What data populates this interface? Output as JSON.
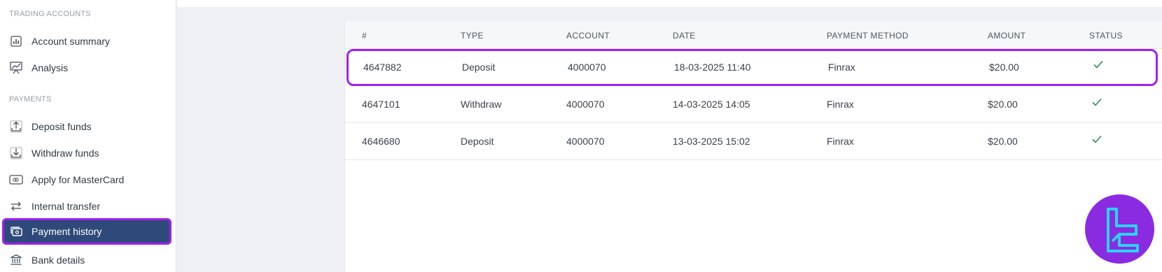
{
  "sidebar": {
    "trading_title": "TRADING ACCOUNTS",
    "payments_title": "PAYMENTS",
    "items": [
      {
        "label": "Account summary",
        "icon": "chart-bars-icon"
      },
      {
        "label": "Analysis",
        "icon": "line-chart-board-icon"
      },
      {
        "label": "Deposit funds",
        "icon": "upload-tray-icon"
      },
      {
        "label": "Withdraw funds",
        "icon": "download-tray-icon"
      },
      {
        "label": "Apply for MasterCard",
        "icon": "card-icon"
      },
      {
        "label": "Internal transfer",
        "icon": "swap-arrows-icon"
      },
      {
        "label": "Payment history",
        "icon": "cash-stack-icon",
        "active": true
      },
      {
        "label": "Bank details",
        "icon": "bank-icon"
      }
    ]
  },
  "table": {
    "headers": [
      "#",
      "TYPE",
      "ACCOUNT",
      "DATE",
      "PAYMENT METHOD",
      "AMOUNT",
      "STATUS"
    ],
    "rows": [
      {
        "id": "4647882",
        "type": "Deposit",
        "account": "4000070",
        "date": "18-03-2025 11:40",
        "method": "Finrax",
        "amount": "$20.00",
        "status": "check-icon"
      },
      {
        "id": "4647101",
        "type": "Withdraw",
        "account": "4000070",
        "date": "14-03-2025 14:05",
        "method": "Finrax",
        "amount": "$20.00",
        "status": "check-icon"
      },
      {
        "id": "4646680",
        "type": "Deposit",
        "account": "4000070",
        "date": "13-03-2025 15:02",
        "method": "Finrax",
        "amount": "$20.00",
        "status": "check-icon"
      }
    ]
  },
  "colors": {
    "accent_highlight": "#a020f0",
    "active_nav_bg": "#2f4a7a",
    "success_check": "#2e8b57",
    "badge_bg": "#8a2be2",
    "badge_glyph": "#29d4ff"
  }
}
